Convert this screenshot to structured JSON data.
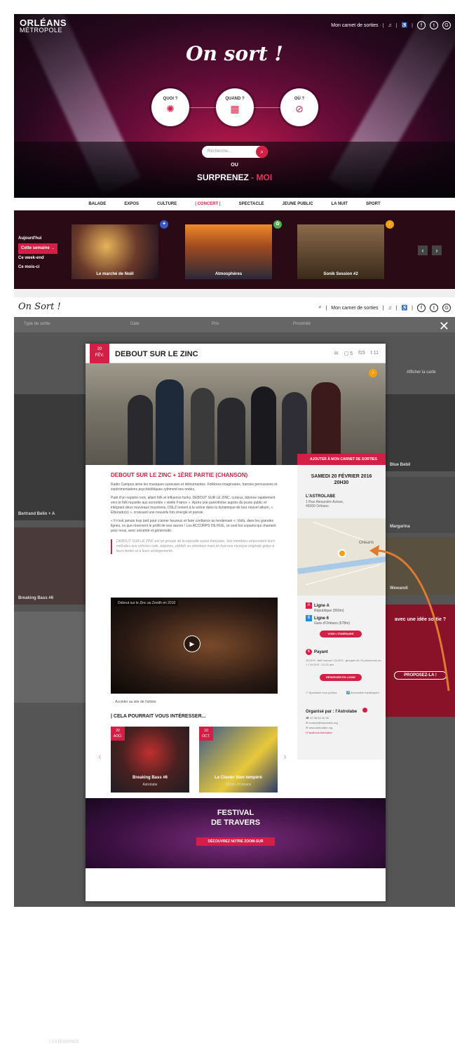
{
  "hero": {
    "logo_line1": "ORLÉANS",
    "logo_line2": "MÉTROPOLE",
    "carnet": "Mon carnet de sorties",
    "title": "On sort !",
    "quoi": "QUOI ?",
    "quand": "QUAND ?",
    "ou_q": "OÙ ?",
    "search_placeholder": "Recherche...",
    "or": "OU",
    "surprise": "SURPRENEZ",
    "moi": "- MOI"
  },
  "categories": [
    "BALADE",
    "EXPOS",
    "CULTURE",
    "| CONCERT |",
    "SPECTACLE",
    "JEUNE PUBLIC",
    "LA NUIT",
    "SPORT"
  ],
  "when": [
    "Aujourd'hui",
    "Cette semaine →",
    "Ce week-end",
    "Ce mois-ci"
  ],
  "carousel_cards": [
    {
      "caption": "Le marché de Noël",
      "color": "#3a57c9"
    },
    {
      "caption": "Atmosphères",
      "color": "#4caf50"
    },
    {
      "caption": "Sonik Session #2",
      "color": "#f2a10e"
    }
  ],
  "header2": {
    "brand": "On Sort !",
    "carnet": "Mon carnet de sorties"
  },
  "filters": {
    "type": "Type de sortie",
    "date": "Date",
    "prix": "Prix",
    "proximite": "Proximité",
    "map": "Afficher la carte"
  },
  "bg_captions": {
    "left1": "Bertrand Belin + A",
    "left2": "Breaking Bass #6",
    "right1": "Blue Bebil",
    "right2": "Margarina",
    "right3": "Wewandi"
  },
  "bg_side": {
    "idea": "avec une idée sortie ?",
    "propose": "PROPOSEZ-LA !"
  },
  "bg_categories": "| CATÉGORIES",
  "modal": {
    "day": "20",
    "month": "FÉV.",
    "title": "DEBOUT SUR LE ZINC",
    "comments": "5",
    "fb": "15",
    "tw": "11",
    "add": "AJOUTER À MON CARNET DE SORTIES",
    "subtitle": "DEBOUT SUR LE ZINC + 1ÈRE PARTIE (CHANSON)",
    "p1": "Radio Campus aime les musiques curieuses et détournantes. Folklores imaginaires, transes percussives et expérimentations psychédéliques rythment ses ondes.",
    "p2": "Parti d'un registre rock, allant folk et influence funky, DEBOUT SUR LE ZINC, curieux, tâtonne rapidement vers le folk musette aux sonorités « vieille France ». Après une parenthèse auprès du jeune public et intégrant deux nouveaux musiciens, DSLZ revient à la scène dans la dynamique de leur nouvel album, « Elborado(s) », croissant une nouvelle fois énergie et poésie.",
    "p3": "« Il n'est jamais trop tard pour s'aimer heureux et faire confiance au lendemain ». Voilà, dans les grandes lignes, ce que réservent le profit de leur œuvre ! Les ACCORPS DE RUE, ce sont les copains qui chantent pour nous, avec sincérité et générosité.",
    "quote": "DEBOUT SUR LE ZINC est un groupe de la nouvelle scène française. Ses membres empruntent leurs mélodies aux rythmes rock, tziganes, yiddish ou orientaux mais en font une musique originale grâce à leurs textes et à leurs arrangements.",
    "video_title": "Debout sur le Zinc au Zenith en 2010",
    "artist_link": "→ Accéder au site de l'artiste",
    "interest": "| CELA POURRAIT VOUS INTÉRESSER...",
    "date_full": "SAMEDI 20 FÉVRIER 2016",
    "time": "20H30",
    "venue": "L'ASTROLABE",
    "address1": "1 Rue Alexandre Avisse,",
    "address2": "45000 Orléans",
    "map_label": "Orléans",
    "line_a": "Ligne A",
    "line_a_sub": "République (550m)",
    "line_6": "Ligne 6",
    "line_6_sub": "Gare d'Orléans (678m)",
    "itinerary": "VOIR L'ITINÉRAIRE",
    "payant": "Payant",
    "prices": "15,00 € : tarif normal / 13,00 € : groupes de 10 personnes ou + / 10,00 € : 12-25 ans",
    "reserve": "RÉSERVER EN LIGNE",
    "spect": "Spectacle tous publics",
    "access": "Accessible handicapés",
    "organizer": "Organisé par : l'Astrolabe",
    "phone": "02 38 54 20 06",
    "email": "contact@lastrolabe.org",
    "web": "www.lastrolabe.org",
    "facebook": "Facebook Astrolabe"
  },
  "suggestions": [
    {
      "day": "20",
      "month": "AOÛ.",
      "title": "Breaking Bass #6",
      "sub": "Astrolabe"
    },
    {
      "day": "10",
      "month": "OCT.",
      "title": "Le Clavier bien tempéré",
      "sub": "Zénith d'Orléans"
    }
  ],
  "festival": {
    "line1": "FESTIVAL",
    "line2": "DE TRAVERS",
    "cta": "DÉCOUVREZ NOTRE ZOOM-SUR"
  }
}
